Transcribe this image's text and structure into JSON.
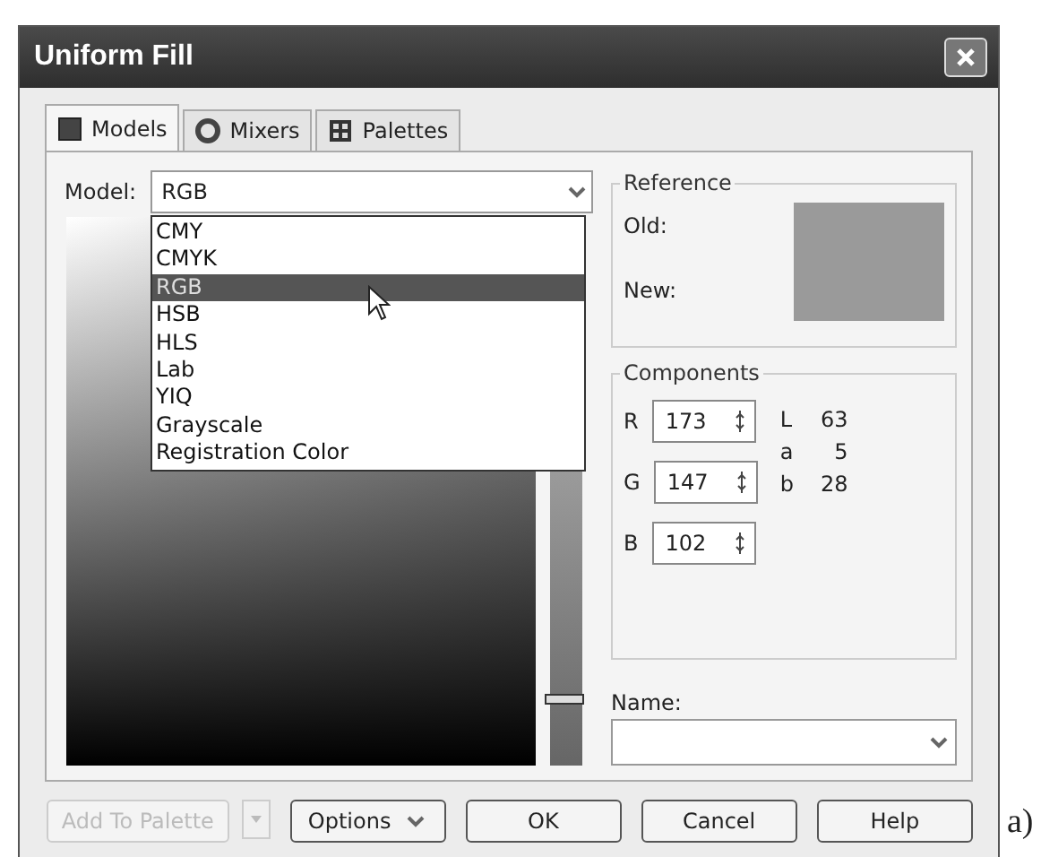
{
  "window": {
    "title": "Uniform Fill"
  },
  "tabs": [
    {
      "label": "Models",
      "selected": true
    },
    {
      "label": "Mixers",
      "selected": false
    },
    {
      "label": "Palettes",
      "selected": false
    }
  ],
  "model": {
    "label": "Model:",
    "value": "RGB",
    "expanded": true,
    "options": [
      {
        "label": "CMY",
        "selected": false
      },
      {
        "label": "CMYK",
        "selected": false
      },
      {
        "label": "RGB",
        "selected": true
      },
      {
        "label": "HSB",
        "selected": false
      },
      {
        "label": "HLS",
        "selected": false
      },
      {
        "label": "Lab",
        "selected": false
      },
      {
        "label": "YIQ",
        "selected": false
      },
      {
        "label": "Grayscale",
        "selected": false
      },
      {
        "label": "Registration Color",
        "selected": false
      }
    ]
  },
  "hue_slider": {
    "level": 0.11
  },
  "reference": {
    "title": "Reference",
    "old_label": "Old:",
    "new_label": "New:"
  },
  "components": {
    "title": "Components",
    "fields": [
      {
        "label": "R",
        "value": "173"
      },
      {
        "label": "G",
        "value": "147"
      },
      {
        "label": "B",
        "value": "102"
      }
    ],
    "lab": [
      {
        "label": "L",
        "value": "63"
      },
      {
        "label": "a",
        "value": "5"
      },
      {
        "label": "b",
        "value": "28"
      }
    ]
  },
  "name": {
    "label": "Name:"
  },
  "buttons": [
    {
      "label": "Add To Palette",
      "kind": "split",
      "disabled": true
    },
    {
      "label": "Options",
      "kind": "menu",
      "disabled": false
    },
    {
      "label": "OK",
      "kind": "plain",
      "disabled": false
    },
    {
      "label": "Cancel",
      "kind": "plain",
      "disabled": false
    },
    {
      "label": "Help",
      "kind": "plain",
      "disabled": false
    }
  ],
  "caption": "a)"
}
